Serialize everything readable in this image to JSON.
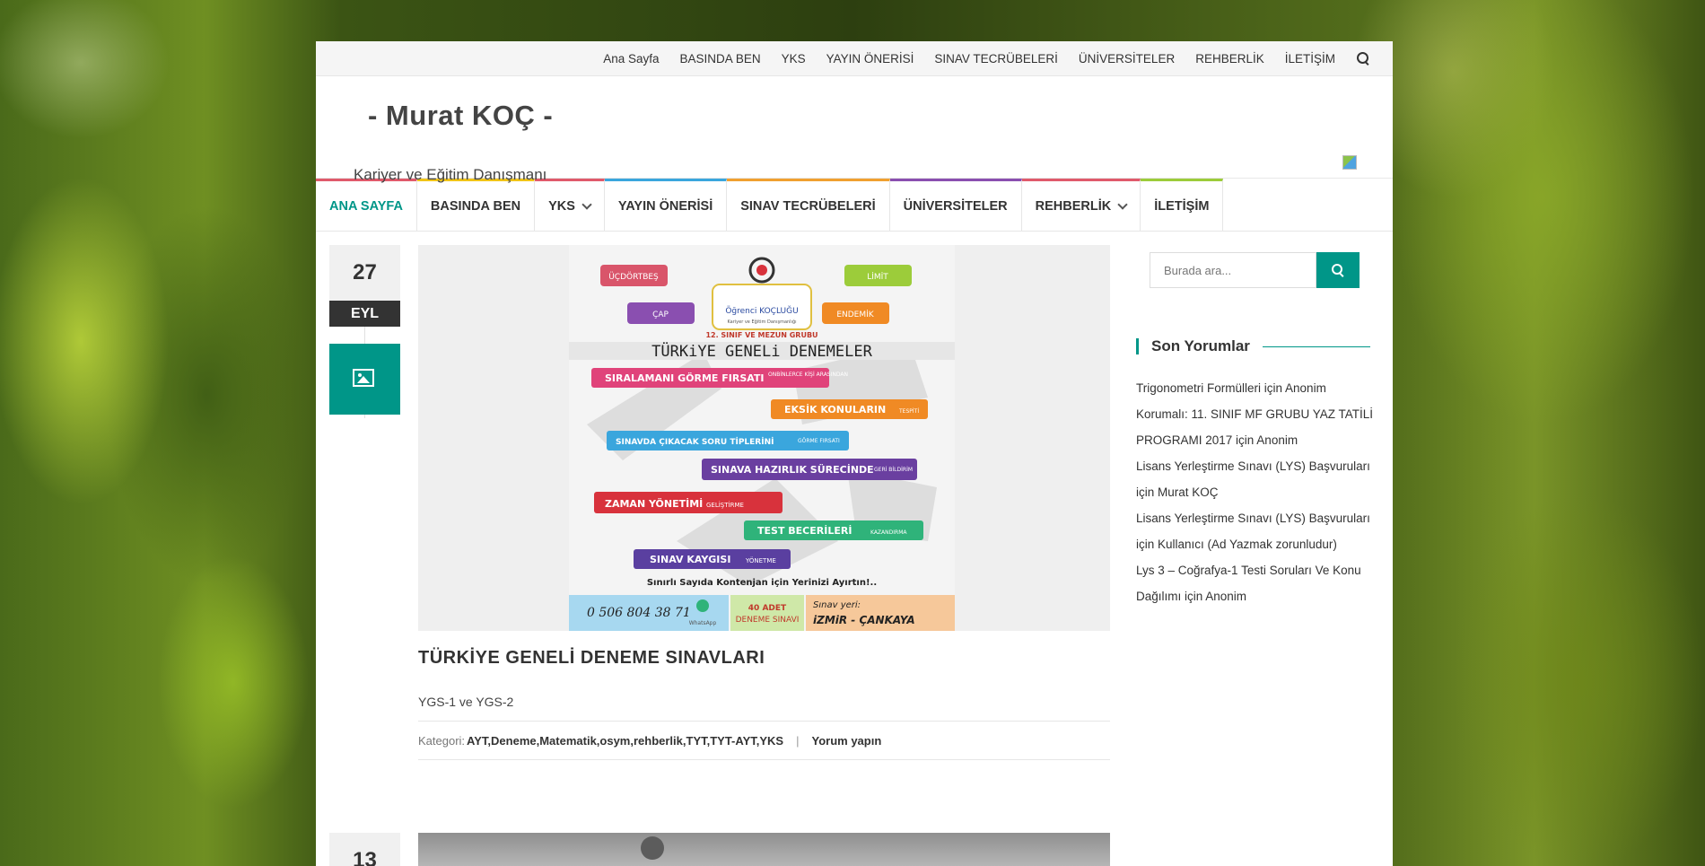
{
  "topbar": {
    "items": [
      "Ana Sayfa",
      "BASINDA BEN",
      "YKS",
      "YAYIN ÖNERİSİ",
      "SINAV TECRÜBELERİ",
      "ÜNİVERSİTELER",
      "REHBERLİK",
      "İLETİŞİM"
    ]
  },
  "site": {
    "title": "- Murat KOÇ -",
    "description": "Kariyer ve Eğitim Danışmanı"
  },
  "nav": [
    {
      "label": "ANA SAYFA",
      "color": "#e05a6b"
    },
    {
      "label": "BASINDA BEN",
      "color": "#f0c419"
    },
    {
      "label": "YKS",
      "color": "#e05a6b"
    },
    {
      "label": "YAYIN ÖNERİSİ",
      "color": "#3aa6dd"
    },
    {
      "label": "SINAV TECRÜBELERİ",
      "color": "#f0a030"
    },
    {
      "label": "ÜNİVERSİTELER",
      "color": "#8a4fb0"
    },
    {
      "label": "REHBERLİK",
      "color": "#e05a6b"
    },
    {
      "label": "İLETİŞİM",
      "color": "#9ccc3a"
    }
  ],
  "post": {
    "day": "27",
    "month": "EYL",
    "title": "TÜRKİYE GENELİ DENEME SINAVLARI",
    "excerpt": "YGS-1 ve YGS-2",
    "category_label": "Kategori:",
    "categories": "AYT,Deneme,Matematik,osym,rehberlik,TYT,TYT-AYT,YKS",
    "comment_link": "Yorum yapın"
  },
  "poster": {
    "tags": [
      "ÜÇDÖRTBEŞ",
      "LİMİT",
      "ÇAP",
      "ENDEMİK"
    ],
    "brand": "Öğrenci KOÇLUĞU",
    "brand_sub": "Kariyer ve Eğitim Danışmanlığı",
    "group": "12. SINIF VE MEZUN GRUBU",
    "heading": "TÜRKiYE GENELi DENEMELER",
    "features": [
      {
        "text": "SIRALAMANI GÖRME FIRSATI",
        "sub": "ONBİNLERCE KİŞİ ARASINDAN",
        "color": "#e0437a"
      },
      {
        "text": "EKSİK KONULARIN",
        "sub": "TESPİTİ",
        "color": "#f08a24"
      },
      {
        "text": "SINAVDA ÇIKACAK SORU TİPLERİNİ",
        "sub": "GÖRME FIRSATI",
        "color": "#3aa6dd"
      },
      {
        "text": "SINAVA HAZIRLIK SÜRECİNDE",
        "sub": "GERİ BİLDİRİM",
        "color": "#6a3fa0"
      },
      {
        "text": "ZAMAN YÖNETİMİ",
        "sub": "GELİŞTİRME",
        "color": "#d8323c"
      },
      {
        "text": "TEST BECERİLERİ",
        "sub": "KAZANDIRMA",
        "color": "#2fb37a"
      },
      {
        "text": "SINAV KAYGISI",
        "sub": "YÖNETME",
        "color": "#5a3fa0"
      }
    ],
    "note": "Sınırlı Sayıda Kontenjan için Yerinizi Ayırtın!..",
    "phone": "0 506 804 38 71",
    "whatsapp": "WhatsApp",
    "count": "40 ADET",
    "count_sub": "DENEME SINAVI",
    "place_label": "Sınav yeri:",
    "place": "iZMiR - ÇANKAYA"
  },
  "post2": {
    "day": "13"
  },
  "sidebar": {
    "search_placeholder": "Burada ara...",
    "widget_title": "Son Yorumlar",
    "comments": [
      "Trigonometri Formülleri için Anonim",
      "Korumalı: 11. SINIF MF GRUBU YAZ TATİLİ PROGRAMI 2017 için Anonim",
      "Lisans Yerleştirme Sınavı (LYS) Başvuruları için Murat KOÇ",
      "Lisans Yerleştirme Sınavı (LYS) Başvuruları için Kullanıcı (Ad Yazmak zorunludur)",
      "Lys 3 – Coğrafya-1 Testi Soruları Ve Konu Dağılımı için Anonim"
    ]
  },
  "colors": {
    "accent": "#009688",
    "dark": "#333333"
  }
}
